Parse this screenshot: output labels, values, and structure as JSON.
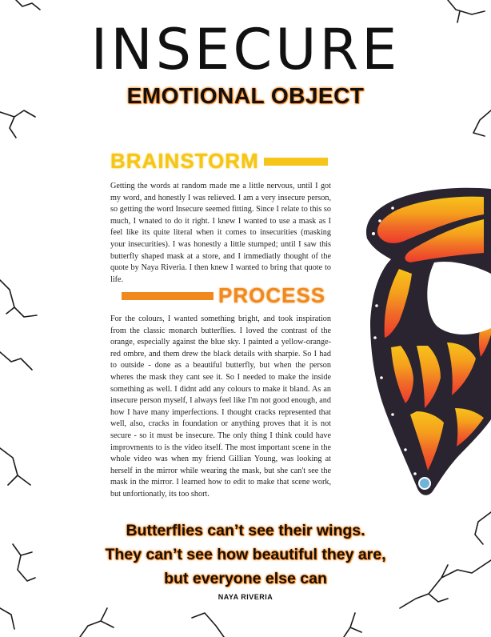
{
  "title": "INSECURE",
  "subtitle": "EMOTIONAL OBJECT",
  "sections": [
    {
      "heading": "BRAINSTORM",
      "accent": "#f5c518",
      "text": "Getting the words at random made me a little nervous, until I got my word, and honestly I was relieved. I am a very insecure person, so getting the word Insecure seemed fitting. Since I relate to this so much, I wnated to do it right. I knew I wanted to use a mask as I feel like its quite literal when it comes to insecurities (masking your insecurities). I was honestly a little stumped; until I saw this butterfly shaped mask at a store, and I immediatly thought of the quote by Naya Riveria. I then knew I wanted to bring that quote to life."
    },
    {
      "heading": "PROCESS",
      "accent": "#f08a1e",
      "text": "For the colours, I wanted something bright, and took inspiration from the classic monarch butterflies. I loved the contrast of the orange, especially against the blue sky. I painted a yellow-orange-red ombre, and them drew the black details with sharpie. So I had to outside - done as a beautiful butterfly, but when the person wheres the mask they cant see it. So I needed to make the inside something as well. I didnt add any colours to make it bland. As an insecure person myself, I always feel like I'm not good enough, and how I have many imperfections. I thought cracks represented that well, also, cracks in foundation or anything proves that it is not secure - so it must be insecure. The only thing I think could have improvments to is the video itself. The most important scene in the whole video was when my friend Gillian Young, was looking at herself in the mirror while wearing the mask, but she can't see the mask in the mirror. I learned how to edit to make that scene work, but unfortionatly, its too short."
    }
  ],
  "quote": {
    "lines": [
      "Butterflies can’t see their wings.",
      "They can’t see how beautiful they are,",
      "but everyone else can"
    ],
    "author": "NAYA RIVERIA"
  },
  "image": {
    "subject": "butterfly-wing-mask",
    "colors": {
      "yellow": "#f7c21b",
      "orange": "#f28a1c",
      "red": "#ee3a2c",
      "outline": "#2a2330"
    }
  },
  "decoration": "crack-lines"
}
